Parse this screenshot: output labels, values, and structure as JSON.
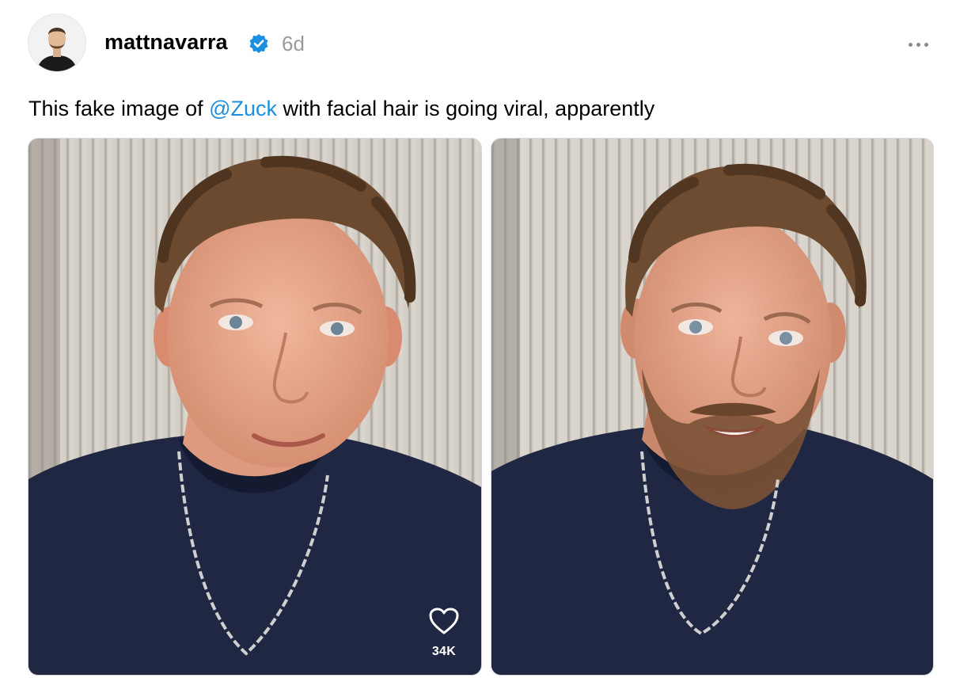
{
  "post": {
    "author": {
      "username": "mattnavarra",
      "verified": true,
      "avatar_icon": "avatar-photo"
    },
    "timestamp": "6d",
    "more_icon": "more-horizontal-icon",
    "text": {
      "before": "This fake image of ",
      "mention": "@Zuck",
      "after": " with facial hair is going viral, apparently"
    },
    "images": [
      {
        "label": "photo-clean-shaven",
        "likes": "34K",
        "like_icon": "heart-icon"
      },
      {
        "label": "photo-with-beard"
      }
    ],
    "colors": {
      "mention": "#1d8fe1",
      "verified_badge": "#1d8fe1",
      "timestamp": "#9a9a9a",
      "shirt": "#1f2742"
    }
  }
}
